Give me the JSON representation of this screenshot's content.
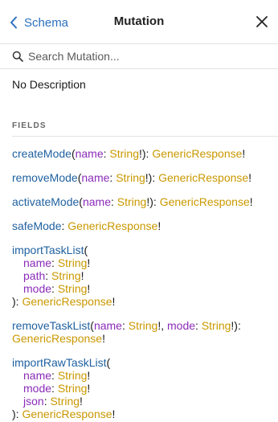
{
  "header": {
    "back_label": "Schema",
    "title": "Mutation"
  },
  "search": {
    "placeholder": "Search Mutation..."
  },
  "description": "No Description",
  "section_title": "FIELDS",
  "fields": {
    "createMode": {
      "name": "createMode",
      "args": [
        {
          "name": "name",
          "type": "String"
        }
      ],
      "type": "GenericResponse"
    },
    "removeMode": {
      "name": "removeMode",
      "args": [
        {
          "name": "name",
          "type": "String"
        }
      ],
      "type": "GenericResponse"
    },
    "activateMode": {
      "name": "activateMode",
      "args": [
        {
          "name": "name",
          "type": "String"
        }
      ],
      "type": "GenericResponse"
    },
    "safeMode": {
      "name": "safeMode",
      "type": "GenericResponse"
    },
    "importTaskList": {
      "name": "importTaskList",
      "args": [
        {
          "name": "name",
          "type": "String"
        },
        {
          "name": "path",
          "type": "String"
        },
        {
          "name": "mode",
          "type": "String"
        }
      ],
      "type": "GenericResponse"
    },
    "removeTaskList": {
      "name": "removeTaskList",
      "args": [
        {
          "name": "name",
          "type": "String"
        },
        {
          "name": "mode",
          "type": "String"
        }
      ],
      "type": "GenericResponse"
    },
    "importRawTaskList": {
      "name": "importRawTaskList",
      "args": [
        {
          "name": "name",
          "type": "String"
        },
        {
          "name": "mode",
          "type": "String"
        },
        {
          "name": "json",
          "type": "String"
        }
      ],
      "type": "GenericResponse"
    }
  },
  "colors": {
    "field_name": "#1f61a0",
    "arg_name": "#8b2bb9",
    "type_name": "#ca9800",
    "link": "#2b6fbf"
  },
  "icons": {
    "back": "chevron-left-icon",
    "close": "close-icon",
    "search": "search-icon"
  }
}
